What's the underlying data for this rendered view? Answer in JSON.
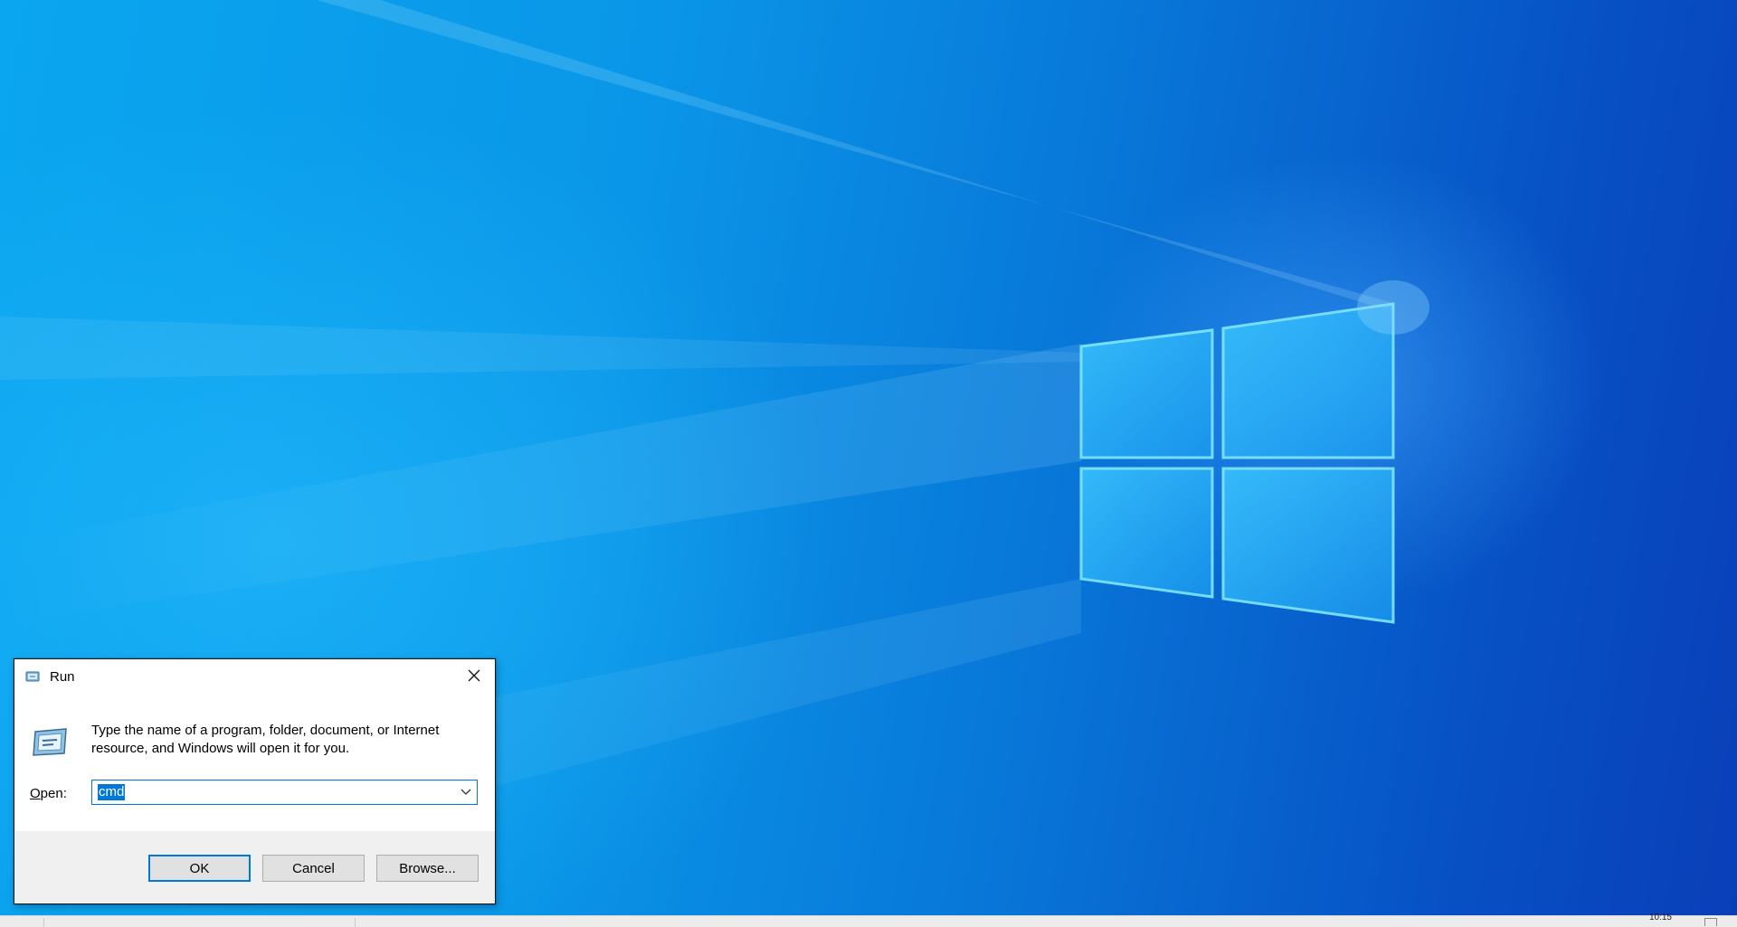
{
  "colors": {
    "desktop_accent": "#0a96e8",
    "selection": "#0078d7",
    "dialog_footer": "#f0f0f0",
    "button_face": "#e1e1e1"
  },
  "run_dialog": {
    "title": "Run",
    "title_icon": "run-icon",
    "close_icon": "close-icon",
    "description": "Type the name of a program, folder, document, or Internet resource, and Windows will open it for you.",
    "open_label_mnemonic": "O",
    "open_label_rest": "pen:",
    "input_value": "cmd",
    "dropdown_icon": "chevron-down-icon",
    "ok_label": "OK",
    "cancel_label": "Cancel",
    "browse_label": "Browse..."
  },
  "taskbar": {
    "clock": "10:15"
  }
}
